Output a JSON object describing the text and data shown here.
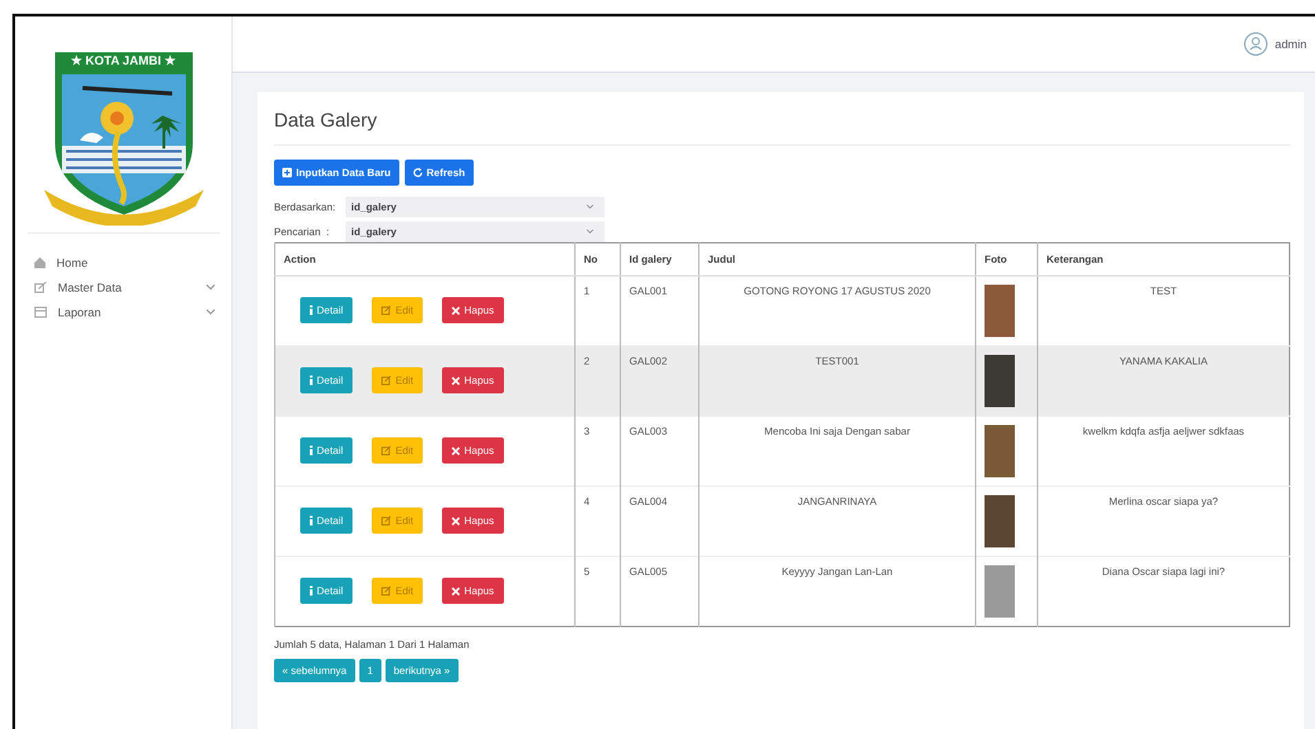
{
  "logo": {
    "title": "★ KOTA JAMBI ★"
  },
  "sidebar": {
    "items": [
      {
        "label": "Home",
        "has_submenu": false
      },
      {
        "label": "Master Data",
        "has_submenu": true
      },
      {
        "label": "Laporan",
        "has_submenu": true
      }
    ]
  },
  "header": {
    "user": "admin"
  },
  "page": {
    "title": "Data Galery",
    "buttons": [
      {
        "label": "Inputkan Data Baru",
        "kind": "add"
      },
      {
        "label": "Refresh",
        "kind": "refresh"
      }
    ],
    "filters": [
      {
        "label": "Berdasarkan:",
        "value": "id_galery"
      },
      {
        "label": "Pencarian  :",
        "value": "id_galery"
      }
    ]
  },
  "table": {
    "columns": [
      "Action",
      "No",
      "Id galery",
      "Judul",
      "Foto",
      "Keterangan"
    ],
    "rows": [
      {
        "actions": [
          "Detail",
          "Edit",
          "Hapus"
        ],
        "no": "1",
        "id": "GAL001",
        "judul": "GOTONG ROYONG 17 AGUSTUS 2020",
        "keterangan": "TEST",
        "selected": false
      },
      {
        "actions": [
          "Detail",
          "Edit",
          "Hapus"
        ],
        "no": "2",
        "id": "GAL002",
        "judul": "TEST001",
        "keterangan": "YANAMA KAKALIA",
        "selected": true
      },
      {
        "actions": [
          "Detail",
          "Edit",
          "Hapus"
        ],
        "no": "3",
        "id": "GAL003",
        "judul": "Mencoba Ini saja Dengan sabar",
        "keterangan": "kwelkm kdqfa asfja aeljwer sdkfaas",
        "selected": false
      },
      {
        "actions": [
          "Detail",
          "Edit",
          "Hapus"
        ],
        "no": "4",
        "id": "GAL004",
        "judul": "JANGANRINAYA",
        "keterangan": "Merlina oscar siapa ya?",
        "selected": false
      },
      {
        "actions": [
          "Detail",
          "Edit",
          "Hapus"
        ],
        "no": "5",
        "id": "GAL005",
        "judul": "Keyyyy Jangan Lan-Lan",
        "keterangan": "Diana Oscar siapa lagi ini?",
        "selected": false
      }
    ]
  },
  "summary": "Jumlah 5 data, Halaman 1 Dari 1 Halaman",
  "pagination": [
    "« sebelumnya",
    "1",
    "berikutnya »"
  ]
}
